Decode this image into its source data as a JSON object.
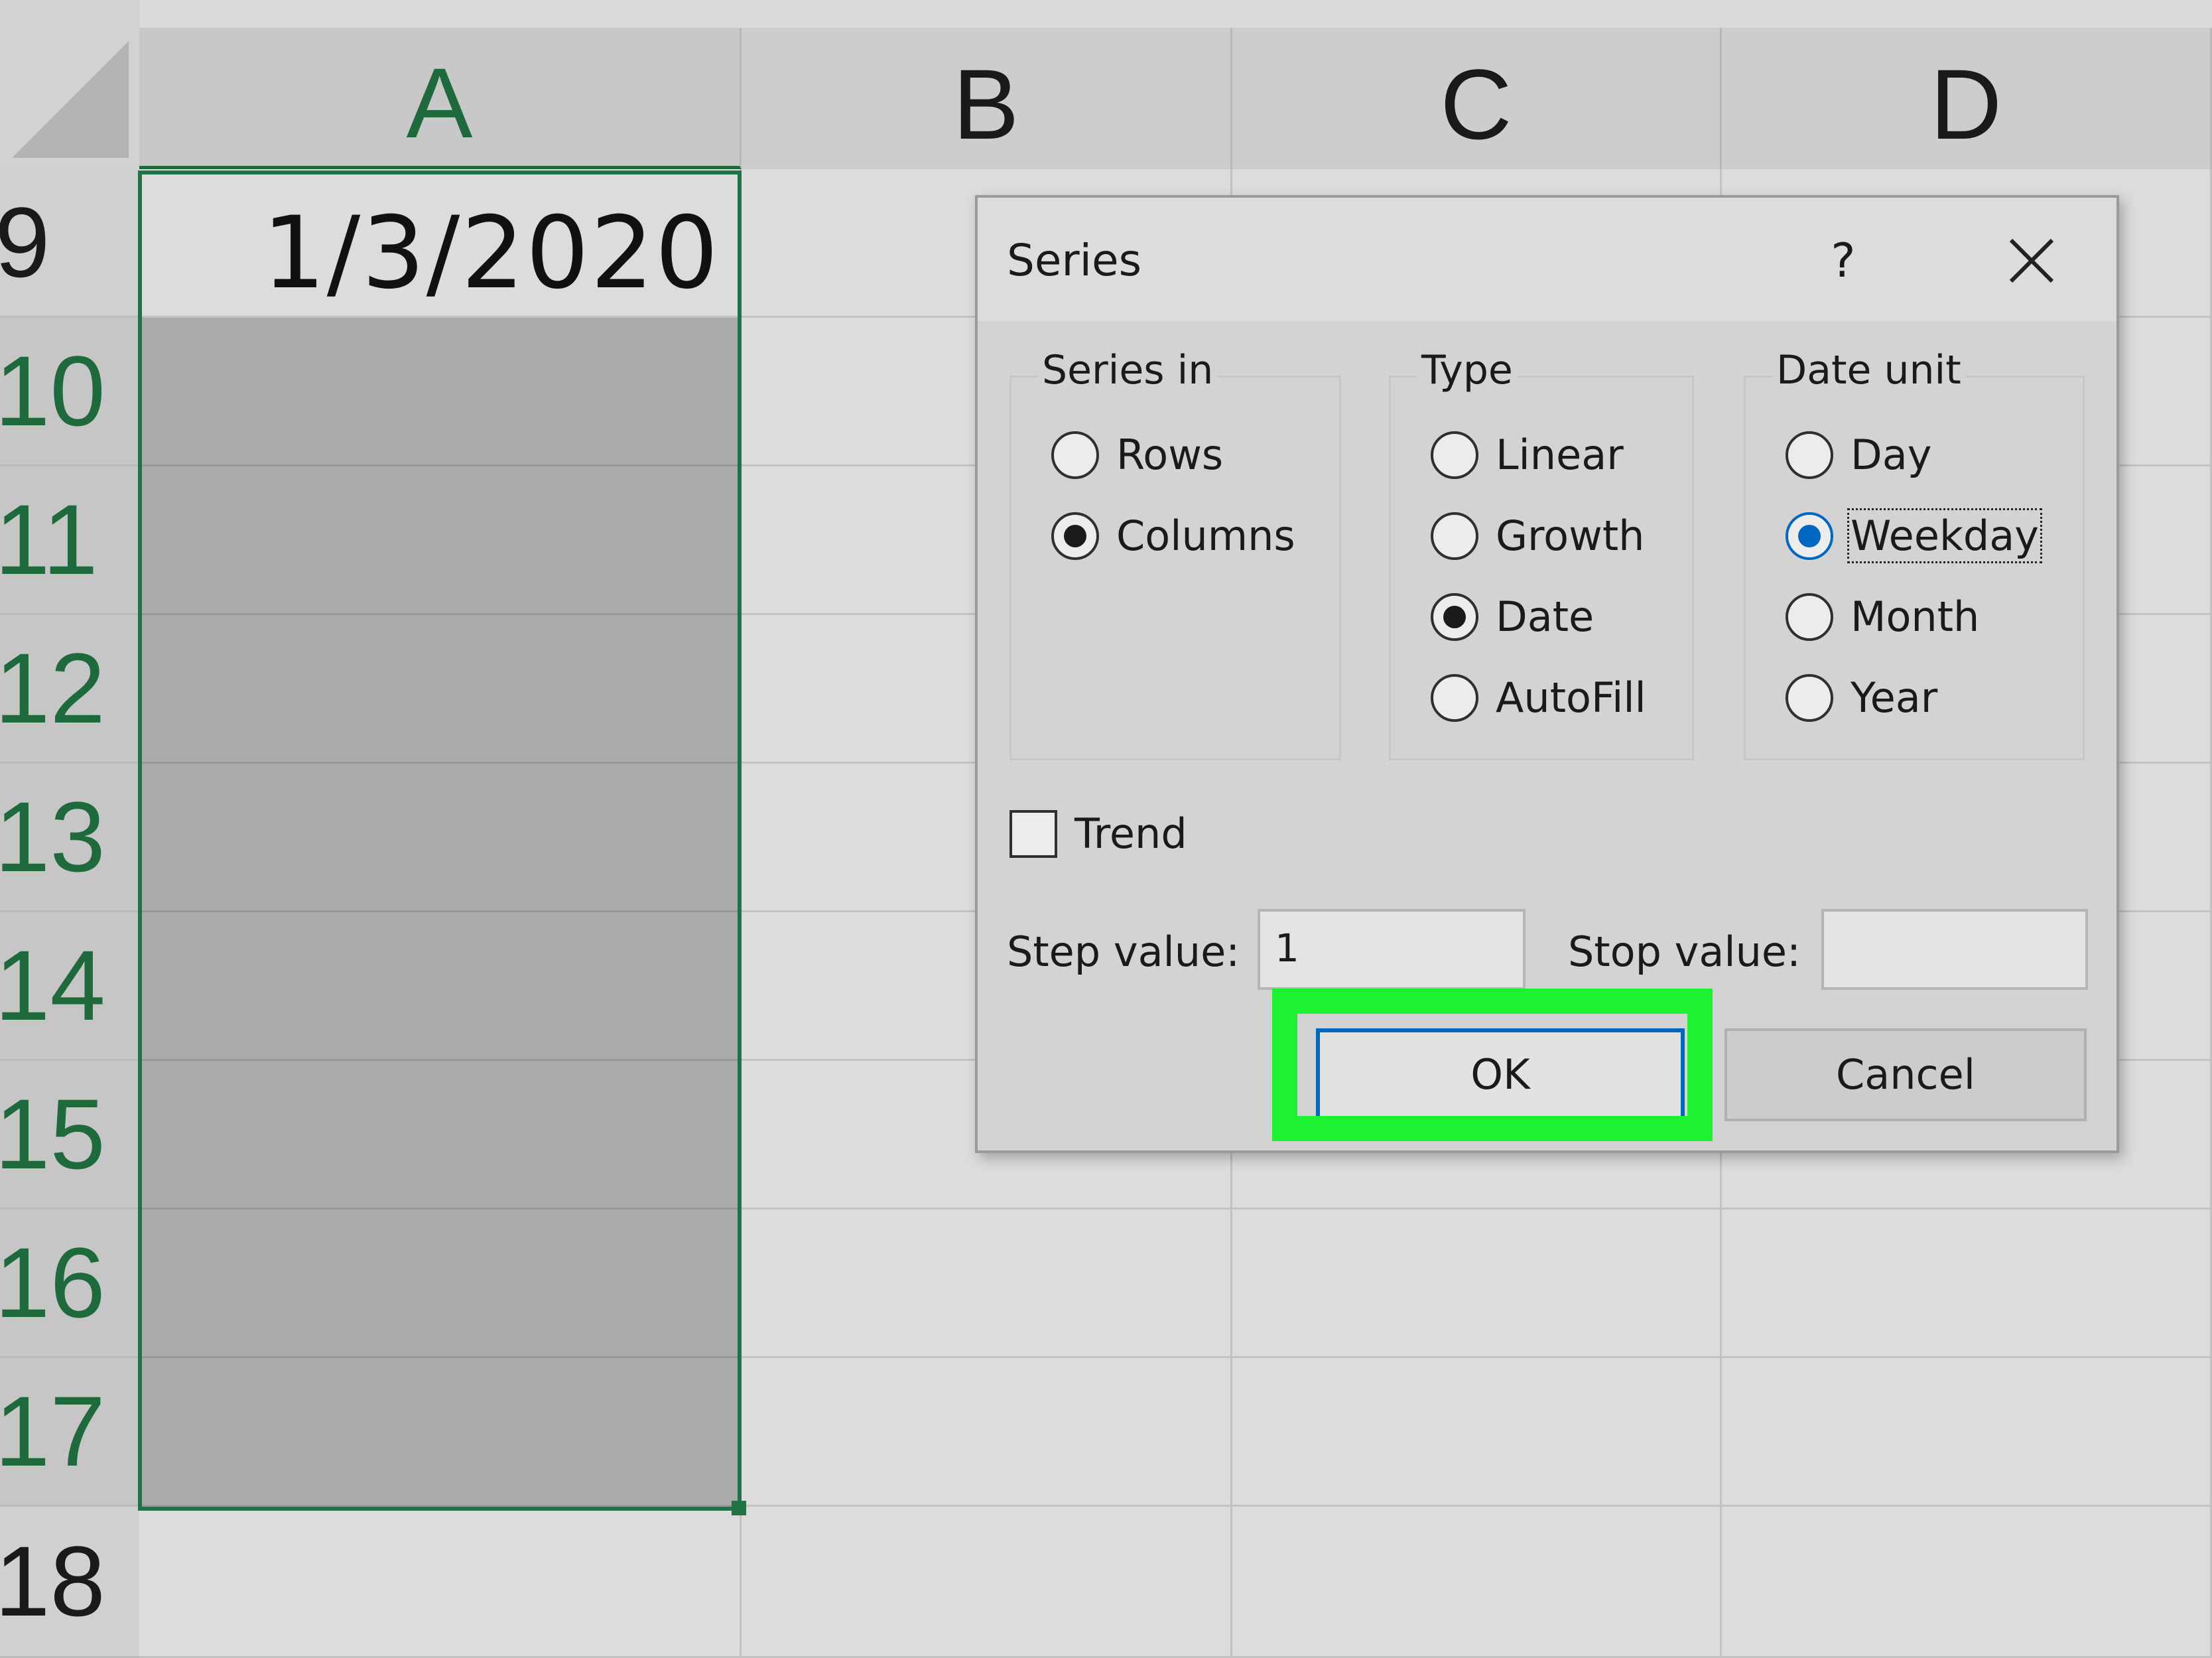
{
  "sheet": {
    "columns": [
      "A",
      "B",
      "C",
      "D"
    ],
    "rows": [
      "9",
      "10",
      "11",
      "12",
      "13",
      "14",
      "15",
      "16",
      "17",
      "18"
    ],
    "a9_value": "1/3/2020"
  },
  "dialog": {
    "title": "Series",
    "help_label": "?",
    "series_in": {
      "label": "Series in",
      "options": [
        "Rows",
        "Columns"
      ],
      "selected": "Columns"
    },
    "type": {
      "label": "Type",
      "options": [
        "Linear",
        "Growth",
        "Date",
        "AutoFill"
      ],
      "selected": "Date"
    },
    "date_unit": {
      "label": "Date unit",
      "options": [
        "Day",
        "Weekday",
        "Month",
        "Year"
      ],
      "selected": "Weekday"
    },
    "trend_label": "Trend",
    "trend_checked": false,
    "step_value_label": "Step value:",
    "step_value": "1",
    "stop_value_label": "Stop value:",
    "stop_value": "",
    "ok_label": "OK",
    "cancel_label": "Cancel"
  },
  "colors": {
    "selection_green": "#217346",
    "highlight_green": "#1EF230",
    "accent_blue": "#0067C0"
  }
}
